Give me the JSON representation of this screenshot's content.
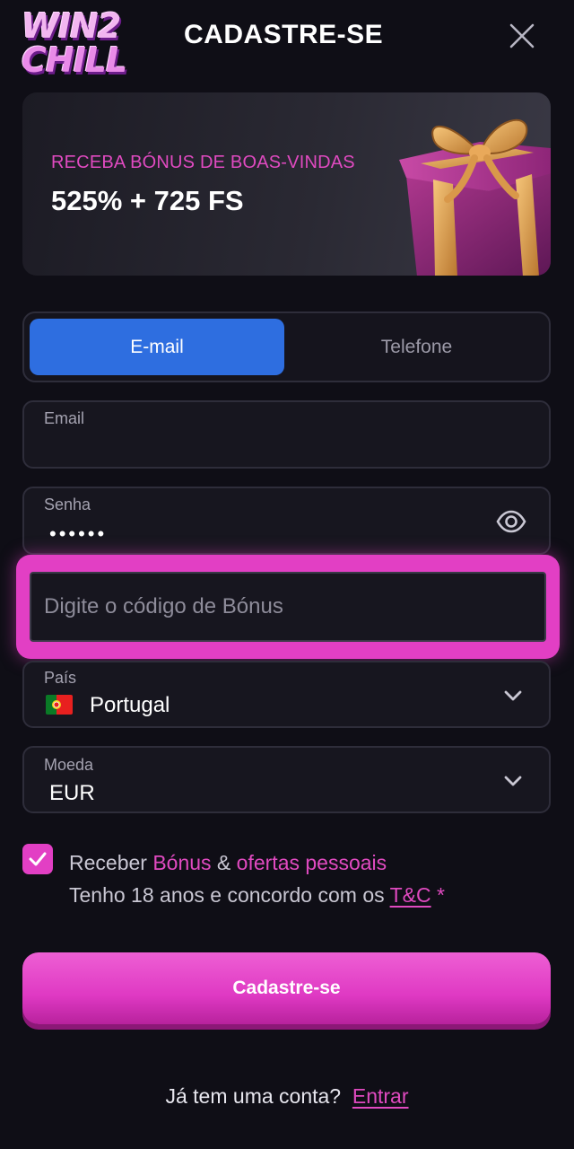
{
  "header": {
    "logo_line1": "WIN2",
    "logo_line2": "CHILL",
    "title": "CADASTRE-SE",
    "close_icon": "close-icon"
  },
  "banner": {
    "subtitle": "RECEBA BÓNUS DE BOAS-VINDAS",
    "headline": "525% + 725 FS",
    "image_icon": "gift-box-icon"
  },
  "tabs": [
    {
      "label": "E-mail",
      "active": true
    },
    {
      "label": "Telefone",
      "active": false
    }
  ],
  "form": {
    "email": {
      "label": "Email",
      "value": ""
    },
    "password": {
      "label": "Senha",
      "value": "••••••",
      "toggle_icon": "eye-icon"
    },
    "bonus": {
      "placeholder": "Digite o código de Bónus",
      "value": ""
    },
    "country": {
      "label": "País",
      "value": "Portugal",
      "flag": "portugal-flag-icon"
    },
    "currency": {
      "label": "Moeda",
      "value": "EUR"
    }
  },
  "consent": {
    "checked": true,
    "prefix": "Receber ",
    "bonus_word": "Bónus",
    "amp": " & ",
    "offers_word": "ofertas pessoais",
    "line2_prefix": "Tenho 18 anos e concordo com os ",
    "tc_link": "T&C",
    "asterisk": " *"
  },
  "submit_label": "Cadastre-se",
  "footer": {
    "question": "Já tem uma conta?",
    "login_link": "Entrar"
  },
  "colors": {
    "background": "#0f0e16",
    "accent_pink": "#e23fc4",
    "tab_active": "#2e6ee0",
    "field_bg": "#17161f"
  }
}
